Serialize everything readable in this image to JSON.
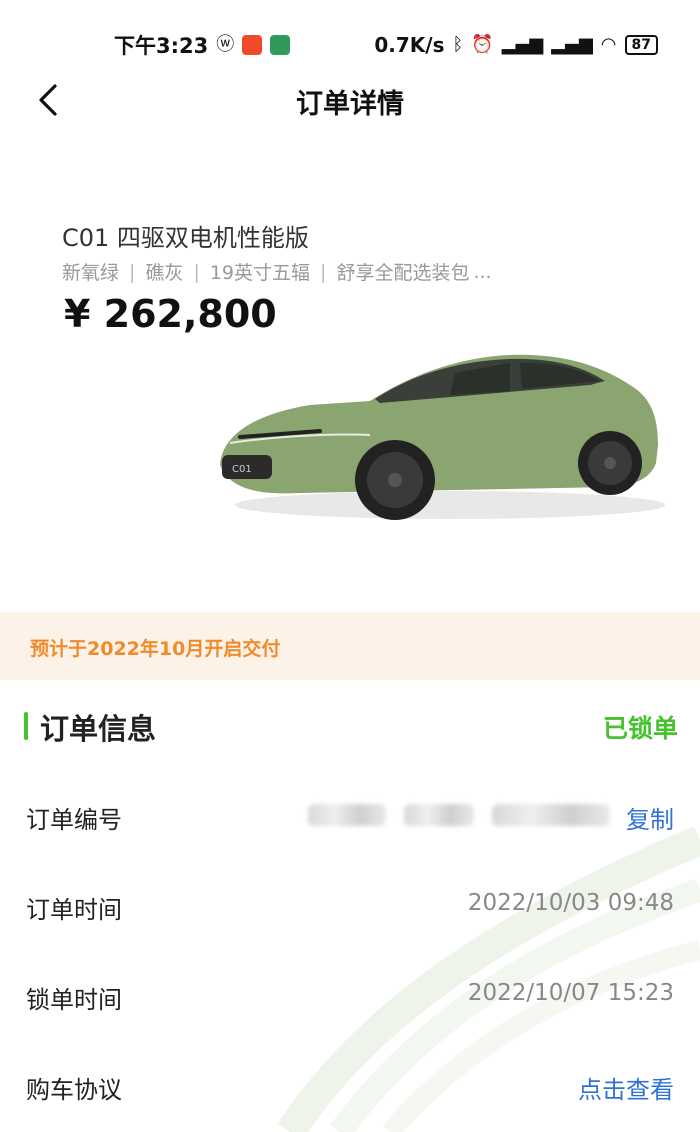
{
  "status_bar": {
    "time": "下午3:23",
    "network_speed": "0.7K/s",
    "battery": "87",
    "icons": [
      "weibo-icon",
      "app-red-icon",
      "app-green-icon",
      "bluetooth-icon",
      "alarm-icon",
      "signal-hd-1-icon",
      "signal-hd-2-icon",
      "wifi-icon",
      "battery-icon"
    ]
  },
  "header": {
    "title": "订单详情",
    "back_icon": "chevron-left-icon"
  },
  "product": {
    "name": "C01 四驱双电机性能版",
    "options": [
      "新氧绿",
      "礁灰",
      "19英寸五辐",
      "舒享全配选装包"
    ],
    "options_more": "...",
    "price": "¥ 262,800",
    "image": "car-image",
    "car_color": "#8aa570"
  },
  "delivery": {
    "text": "预计于2022年10月开启交付",
    "color": "#f08b2c",
    "background": "#fdf2e8"
  },
  "order_info": {
    "title": "订单信息",
    "status": "已锁单",
    "accent": "#44c32c",
    "rows": [
      {
        "label": "订单编号",
        "value": "",
        "action": "复制"
      },
      {
        "label": "订单时间",
        "value": "2022/10/03 09:48"
      },
      {
        "label": "锁单时间",
        "value": "2022/10/07 15:23"
      },
      {
        "label": "购车协议",
        "action": "点击查看"
      }
    ]
  },
  "link_color": "#2f72d4"
}
